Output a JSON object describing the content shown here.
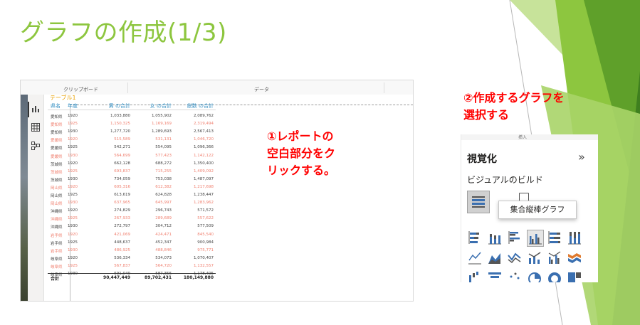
{
  "slide": {
    "title": "グラフの作成(1/3)"
  },
  "ribbon": {
    "clipboard_label": "クリップボード",
    "data_label": "データ"
  },
  "table_visual": {
    "title": "テーブル1",
    "headers": [
      "県名",
      "年度",
      "男 の合計",
      "女 の合計",
      "総数 の合計"
    ],
    "rows": [
      {
        "pref": "愛知県",
        "year": "1920",
        "m": "1,033,880",
        "f": "1,055,902",
        "t": "2,089,762"
      },
      {
        "pref": "愛知県",
        "year": "1925",
        "m": "1,150,325",
        "f": "1,169,169",
        "t": "2,319,494"
      },
      {
        "pref": "愛知県",
        "year": "1930",
        "m": "1,277,720",
        "f": "1,289,693",
        "t": "2,567,413"
      },
      {
        "pref": "愛媛県",
        "year": "1920",
        "m": "515,589",
        "f": "531,131",
        "t": "1,046,720"
      },
      {
        "pref": "愛媛県",
        "year": "1925",
        "m": "542,271",
        "f": "554,095",
        "t": "1,096,366"
      },
      {
        "pref": "愛媛県",
        "year": "1930",
        "m": "564,699",
        "f": "577,423",
        "t": "1,142,122"
      },
      {
        "pref": "茨城県",
        "year": "1920",
        "m": "662,128",
        "f": "688,272",
        "t": "1,350,400"
      },
      {
        "pref": "茨城県",
        "year": "1925",
        "m": "693,837",
        "f": "715,255",
        "t": "1,409,092"
      },
      {
        "pref": "茨城県",
        "year": "1930",
        "m": "734,059",
        "f": "753,038",
        "t": "1,487,097"
      },
      {
        "pref": "岡山県",
        "year": "1920",
        "m": "605,316",
        "f": "612,382",
        "t": "1,217,698"
      },
      {
        "pref": "岡山県",
        "year": "1925",
        "m": "613,619",
        "f": "624,828",
        "t": "1,238,447"
      },
      {
        "pref": "岡山県",
        "year": "1930",
        "m": "637,965",
        "f": "645,997",
        "t": "1,283,962"
      },
      {
        "pref": "沖縄県",
        "year": "1920",
        "m": "274,829",
        "f": "296,743",
        "t": "571,572"
      },
      {
        "pref": "沖縄県",
        "year": "1925",
        "m": "267,933",
        "f": "289,689",
        "t": "557,622"
      },
      {
        "pref": "沖縄県",
        "year": "1930",
        "m": "272,797",
        "f": "304,712",
        "t": "577,509"
      },
      {
        "pref": "岩手県",
        "year": "1920",
        "m": "421,069",
        "f": "424,471",
        "t": "845,540"
      },
      {
        "pref": "岩手県",
        "year": "1925",
        "m": "448,637",
        "f": "452,347",
        "t": "900,984"
      },
      {
        "pref": "岩手県",
        "year": "1930",
        "m": "486,925",
        "f": "488,846",
        "t": "975,771"
      },
      {
        "pref": "岐阜県",
        "year": "1920",
        "m": "536,334",
        "f": "534,073",
        "t": "1,070,407"
      },
      {
        "pref": "岐阜県",
        "year": "1925",
        "m": "567,837",
        "f": "564,720",
        "t": "1,132,557"
      },
      {
        "pref": "岐阜県",
        "year": "1930",
        "m": "591,049",
        "f": "587,356",
        "t": "1,178,405"
      }
    ],
    "total": {
      "label": "合計",
      "m": "90,447,449",
      "f": "89,702,431",
      "t": "180,149,880"
    }
  },
  "callouts": {
    "step1_lines": [
      "①レポートの",
      "空白部分をク",
      "リックする。"
    ],
    "step2_lines": [
      "②作成するグラフを",
      "選択する"
    ]
  },
  "viz_pane": {
    "top_strip": "挿入",
    "title": "視覚化",
    "collapse_glyph": "»",
    "build_label": "ビジュアルのビルド",
    "tooltip": "集合縦棒グラフ"
  },
  "icons": {
    "report_view": "bar-chart-icon",
    "data_view": "table-grid-icon",
    "model_view": "model-diagram-icon"
  },
  "colors": {
    "title_green": "#8dc63f",
    "callout_red": "#ff0000",
    "header_blue": "#2e8bc0",
    "visual_title_orange": "#e8a000",
    "alt_row_salmon": "#f08070",
    "viz_icon_blue": "#3a6fb0",
    "viz_icon_orange": "#e07a2e"
  }
}
